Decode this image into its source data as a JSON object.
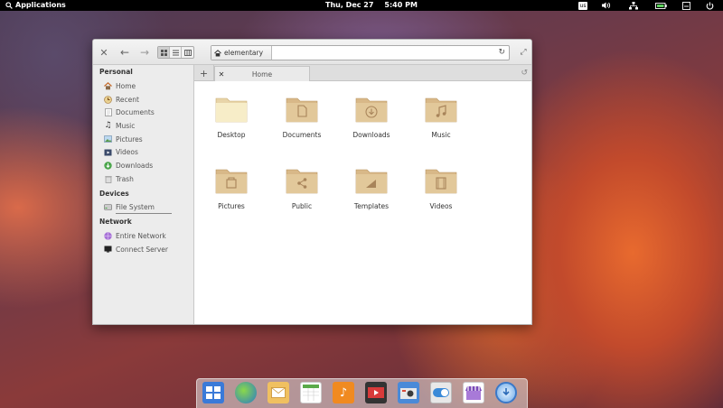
{
  "panel": {
    "applications_label": "Applications",
    "date": "Thu, Dec 27",
    "time": "5:40 PM",
    "keyboard_layout": "us"
  },
  "window": {
    "path": "elementary",
    "sidebar": {
      "sections": [
        {
          "title": "Personal",
          "items": [
            {
              "label": "Home",
              "icon": "home-icon"
            },
            {
              "label": "Recent",
              "icon": "recent-icon"
            },
            {
              "label": "Documents",
              "icon": "documents-icon"
            },
            {
              "label": "Music",
              "icon": "music-icon"
            },
            {
              "label": "Pictures",
              "icon": "pictures-icon"
            },
            {
              "label": "Videos",
              "icon": "videos-icon"
            },
            {
              "label": "Downloads",
              "icon": "downloads-icon"
            },
            {
              "label": "Trash",
              "icon": "trash-icon"
            }
          ]
        },
        {
          "title": "Devices",
          "items": [
            {
              "label": "File System",
              "icon": "drive-icon"
            }
          ]
        },
        {
          "title": "Network",
          "items": [
            {
              "label": "Entire Network",
              "icon": "network-icon"
            },
            {
              "label": "Connect Server",
              "icon": "server-icon"
            }
          ]
        }
      ]
    },
    "tab": {
      "label": "Home"
    },
    "folders": [
      {
        "label": "Desktop",
        "icon": "desktop-folder-icon"
      },
      {
        "label": "Documents",
        "icon": "documents-folder-icon"
      },
      {
        "label": "Downloads",
        "icon": "downloads-folder-icon"
      },
      {
        "label": "Music",
        "icon": "music-folder-icon"
      },
      {
        "label": "Pictures",
        "icon": "pictures-folder-icon"
      },
      {
        "label": "Public",
        "icon": "public-folder-icon"
      },
      {
        "label": "Templates",
        "icon": "templates-folder-icon"
      },
      {
        "label": "Videos",
        "icon": "videos-folder-icon"
      }
    ]
  },
  "dock": {
    "apps": [
      "multitasking-view",
      "web-browser",
      "mail",
      "calendar",
      "music",
      "videos",
      "photos",
      "system-settings",
      "app-center",
      "software-update"
    ]
  }
}
